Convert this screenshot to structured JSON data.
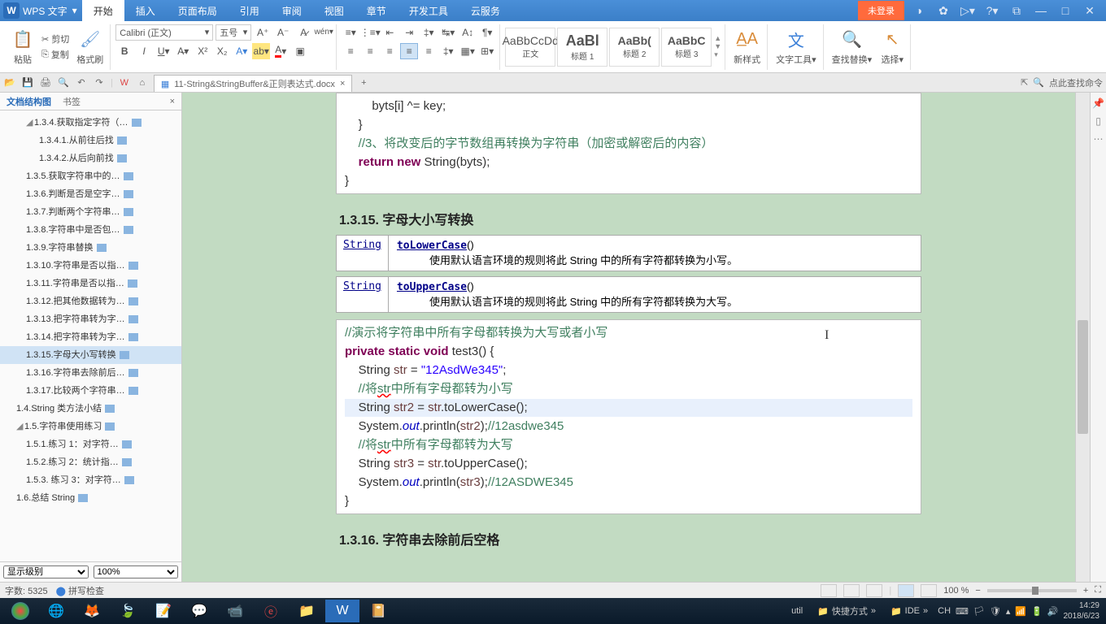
{
  "app": {
    "name": "WPS 文字",
    "login": "未登录"
  },
  "menu": [
    "开始",
    "插入",
    "页面布局",
    "引用",
    "审阅",
    "视图",
    "章节",
    "开发工具",
    "云服务"
  ],
  "ribbon": {
    "paste": "粘贴",
    "cut": "剪切",
    "copy": "复制",
    "brush": "格式刷",
    "font": "Calibri (正文)",
    "size": "五号",
    "styles": [
      {
        "preview": "AaBbCcDd",
        "name": "正文"
      },
      {
        "preview": "AaBl",
        "name": "标题 1"
      },
      {
        "preview": "AaBb(",
        "name": "标题 2"
      },
      {
        "preview": "AaBbC",
        "name": "标题 3"
      }
    ],
    "newstyle": "新样式",
    "texttool": "文字工具",
    "findreplace": "查找替换",
    "select": "选择"
  },
  "doc_tab": "11-String&StringBuffer&正则表达式.docx",
  "search_hint": "点此查找命令",
  "sidebar": {
    "tab1": "文档结构图",
    "tab2": "书签",
    "items": [
      {
        "lvl": "l1",
        "collapse": "◢",
        "text": "1.3.4.获取指定字符（…"
      },
      {
        "lvl": "",
        "text": "1.3.4.1.从前往后找"
      },
      {
        "lvl": "",
        "text": "1.3.4.2.从后向前找"
      },
      {
        "lvl": "l1",
        "text": "1.3.5.获取字符串中的…"
      },
      {
        "lvl": "l1",
        "text": "1.3.6.判断是否是空字…"
      },
      {
        "lvl": "l1",
        "text": "1.3.7.判断两个字符串…"
      },
      {
        "lvl": "l1",
        "text": "1.3.8.字符串中是否包…"
      },
      {
        "lvl": "l1",
        "text": "1.3.9.字符串替换"
      },
      {
        "lvl": "l1",
        "text": "1.3.10.字符串是否以指…"
      },
      {
        "lvl": "l1",
        "text": "1.3.11.字符串是否以指…"
      },
      {
        "lvl": "l1",
        "text": "1.3.12.把其他数据转为…"
      },
      {
        "lvl": "l1",
        "text": "1.3.13.把字符串转为字…"
      },
      {
        "lvl": "l1",
        "text": "1.3.14.把字符串转为字…"
      },
      {
        "lvl": "l1",
        "text": "1.3.15.字母大小写转换",
        "active": true
      },
      {
        "lvl": "l1",
        "text": "1.3.16.字符串去除前后…"
      },
      {
        "lvl": "l1",
        "text": "1.3.17.比较两个字符串…"
      },
      {
        "lvl": "l0",
        "text": "1.4.String 类方法小结"
      },
      {
        "lvl": "l0",
        "collapse": "◢",
        "text": "1.5.字符串使用练习"
      },
      {
        "lvl": "l1",
        "text": "1.5.1.练习 1：对字符…"
      },
      {
        "lvl": "l1",
        "text": "1.5.2.练习 2：统计指…"
      },
      {
        "lvl": "l1",
        "text": "1.5.3. 练习 3：对字符…"
      },
      {
        "lvl": "l0",
        "text": "1.6.总结 String"
      }
    ],
    "display_level": "显示级别",
    "zoom": "100%"
  },
  "content": {
    "code1_l1": "        byts[i] ^= key;",
    "code1_l2": "    }",
    "code1_cmt": "    //3、将改变后的字节数组再转换为字符串（加密或解密后的内容）",
    "code1_ret": "    return new ",
    "code1_ret2": "String(byts);",
    "code1_l5": "}",
    "h1": "1.3.15. 字母大小写转换",
    "api1_left": "String",
    "api1_method": "toLowerCase",
    "api1_desc": "使用默认语言环境的规则将此 String 中的所有字符都转换为小写。",
    "api2_left": "String",
    "api2_method": "toUpperCase",
    "api2_desc": "使用默认语言环境的规则将此 String 中的所有字符都转换为大写。",
    "c2_cmt1": "//演示将字符串中所有字母都转换为大写或者小写",
    "c2_sig": "private static void",
    "c2_sig2": " test3() {",
    "c2_l2a": "    String ",
    "c2_l2b": "str",
    "c2_l2c": " = ",
    "c2_l2d": "\"12AsdWe345\"",
    "c2_l2e": ";",
    "c2_cmt2": "    //将",
    "c2_cmt2b": "str",
    "c2_cmt2c": "中所有字母都转为小写",
    "c2_l4a": "    String ",
    "c2_l4b": "str2",
    "c2_l4c": " = ",
    "c2_l4d": "str",
    "c2_l4e": ".toLowerCase();",
    "c2_l5a": "    System.",
    "c2_l5b": "out",
    "c2_l5c": ".println(",
    "c2_l5d": "str2",
    "c2_l5e": ");",
    "c2_l5f": "//12asdwe345",
    "c2_cmt3": "    //将",
    "c2_cmt3b": "str",
    "c2_cmt3c": "中所有字母都转为大写",
    "c2_l7a": "    String ",
    "c2_l7b": "str3",
    "c2_l7c": " = ",
    "c2_l7d": "str",
    "c2_l7e": ".toUpperCase();",
    "c2_l8a": "    System.",
    "c2_l8b": "out",
    "c2_l8c": ".println(",
    "c2_l8d": "str3",
    "c2_l8e": ");",
    "c2_l8f": "//12ASDWE345",
    "c2_l9": "}",
    "h2": "1.3.16. 字符串去除前后空格"
  },
  "status": {
    "words": "字数: 5325",
    "spell": "拼写检查",
    "zoom": "100 %"
  },
  "taskbar": {
    "util": "util",
    "shortcut": "快捷方式",
    "ide": "IDE",
    "lang": "CH",
    "time": "14:29",
    "date": "2018/6/23"
  }
}
